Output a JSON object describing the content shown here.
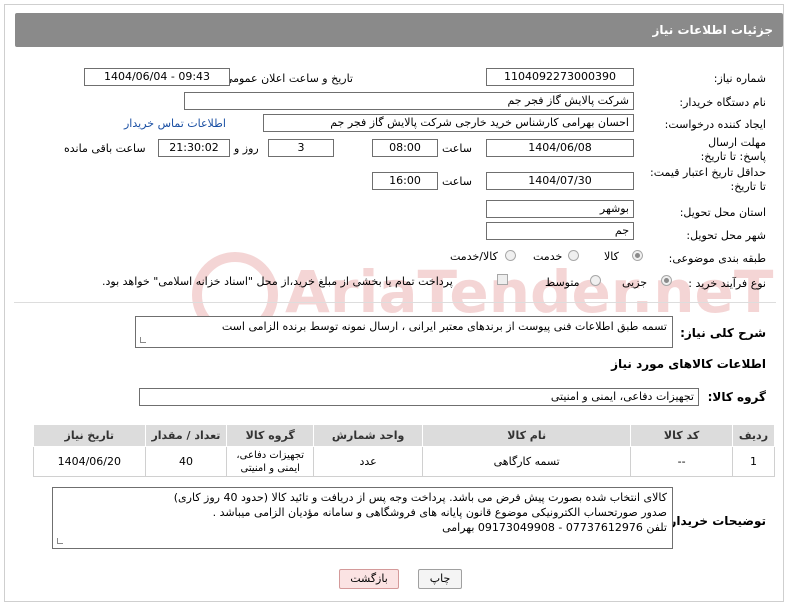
{
  "header": {
    "title": "جزئیات اطلاعات نیاز"
  },
  "form": {
    "need_number_label": "شماره نیاز:",
    "need_number": "1104092273000390",
    "announce_label": "تاریخ و ساعت اعلان عمومی:",
    "announce_value": "1404/06/04 - 09:43",
    "buyer_org_label": "نام دستگاه خریدار:",
    "buyer_org": "شرکت پالایش گاز فجر جم",
    "creator_label": "ایجاد کننده درخواست:",
    "creator": "احسان بهرامی کارشناس خرید خارجی شرکت پالایش گاز فجر جم",
    "contact_link": "اطلاعات تماس خریدار",
    "reply_deadline_label": "مهلت ارسال پاسخ: تا تاریخ:",
    "reply_date": "1404/06/08",
    "hour_label": "ساعت",
    "reply_time": "08:00",
    "days_value": "3",
    "days_label": "روز و",
    "remaining_time": "21:30:02",
    "remaining_label": "ساعت باقی مانده",
    "price_validity_label": "حداقل تاریخ اعتبار قیمت: تا تاریخ:",
    "price_date": "1404/07/30",
    "price_time": "16:00",
    "province_label": "استان محل تحویل:",
    "province": "بوشهر",
    "city_label": "شهر محل تحویل:",
    "city": "جم",
    "category_label": "طبقه بندی موضوعی:",
    "category_options": [
      "کالا",
      "خدمت",
      "کالا/خدمت"
    ],
    "category_selected": "کالا",
    "process_label": "نوع فرآیند خرید :",
    "process_options": [
      "جزیی",
      "متوسط"
    ],
    "process_selected": "جزیی",
    "payment_note": "پرداخت تمام یا بخشی از مبلغ خرید،از محل \"اسناد خزانه اسلامی\" خواهد بود."
  },
  "description": {
    "label": "شرح کلی نیاز:",
    "text": "تسمه طبق اطلاعات فنی پیوست از برندهای معتبر ایرانی ، ارسال نمونه توسط برنده الزامی است"
  },
  "goods": {
    "section_title": "اطلاعات کالاهای مورد نیاز",
    "group_label": "گروه کالا:",
    "group_value": "تجهیزات دفاعی، ایمنی و امنیتی",
    "columns": [
      "ردیف",
      "کد کالا",
      "نام کالا",
      "واحد شمارش",
      "گروه کالا",
      "تعداد / مقدار",
      "تاریخ نیاز"
    ],
    "rows": [
      {
        "row": "1",
        "code": "--",
        "name": "تسمه کارگاهی",
        "unit": "عدد",
        "group_line1": "تجهیزات دفاعی،",
        "group_line2": "ایمنی و امنیتی",
        "qty": "40",
        "date": "1404/06/20"
      }
    ]
  },
  "buyer_notes": {
    "label": "توضیحات خریدار:",
    "line1": "کالای انتخاب شده بصورت پیش فرض می باشد. پرداخت وجه پس از دریافت و تائید کالا (حدود 40 روز کاری)",
    "line2": "صدور صورتحساب الکترونیکی موضوع قانون پایانه های فروشگاهی و سامانه مؤدیان الزامی میباشد .",
    "line3": "تلفن 07737612976 - 09173049908 بهرامی"
  },
  "buttons": {
    "print": "چاپ",
    "back": "بازگشت"
  },
  "watermark": {
    "text": "AriaTender.neT"
  },
  "colors": {
    "header": "#8a8a8a",
    "link": "#1a4fa3",
    "back_button": "#fbe3e3"
  }
}
